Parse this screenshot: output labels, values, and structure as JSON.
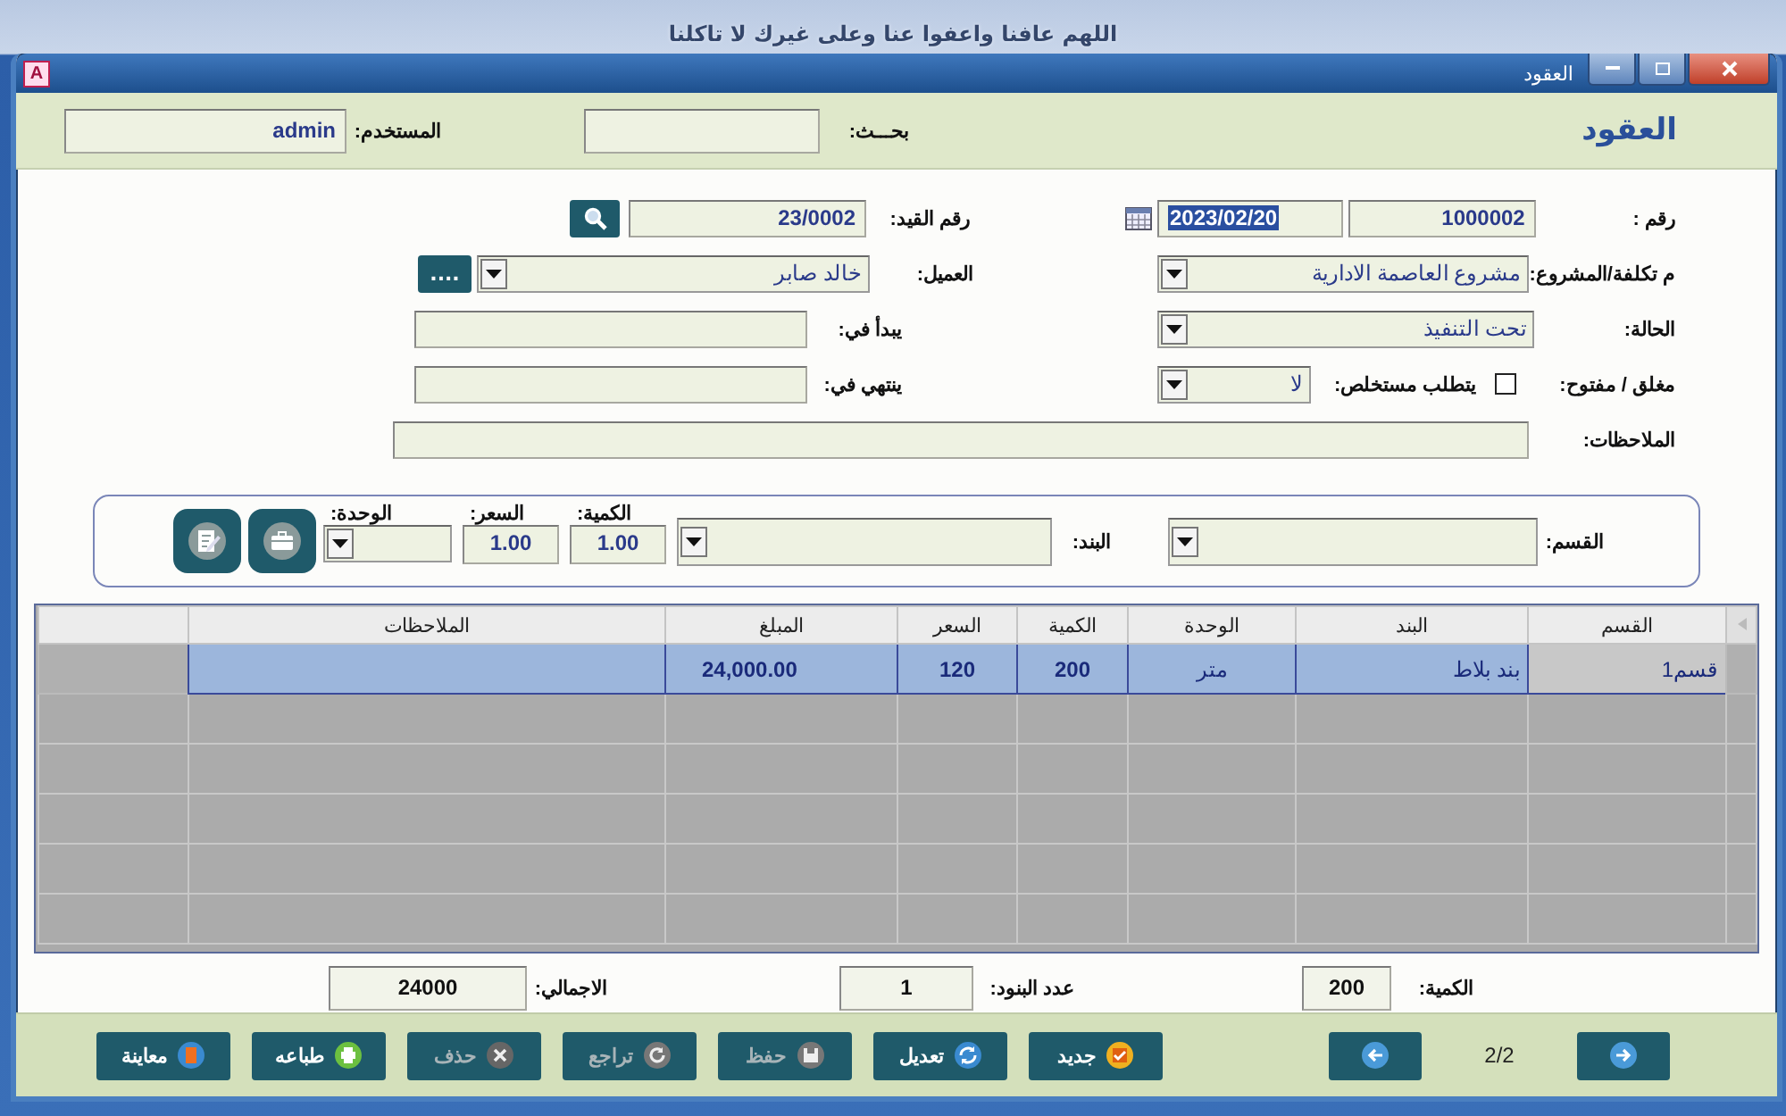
{
  "banner": {
    "text": "اللهم عافنا واعفوا عنا وعلى غيرك لا تاكلنا"
  },
  "window": {
    "app_badge": "A",
    "title": "العقود"
  },
  "header": {
    "title": "العقود",
    "search_label": "بحـــث:",
    "user_label": "المستخدم:",
    "user_value": "admin"
  },
  "contract": {
    "number": {
      "label": "رقم :",
      "value": "1000002"
    },
    "date": {
      "value": "2023/02/20",
      "selected": true
    },
    "entry_no": {
      "label": "رقم القيد:",
      "value": "23/0002"
    },
    "project": {
      "label": "م تكلفة/المشروع:",
      "value": "مشروع العاصمة الادارية"
    },
    "client": {
      "label": "العميل:",
      "value": "خالد صابر",
      "more_button": "...."
    },
    "status": {
      "label": "الحالة:",
      "value": "تحت التنفيذ"
    },
    "starts": {
      "label": "يبدأ في:"
    },
    "closed": {
      "label": "مغلق / مفتوح:",
      "checked": false
    },
    "requires_statement": {
      "label": "يتطلب مستخلص:",
      "value": "لا"
    },
    "ends": {
      "label": "ينتهي في:"
    },
    "notes": {
      "label": "الملاحظات:"
    }
  },
  "entry_panel": {
    "section": {
      "label": "القسم:"
    },
    "item": {
      "label": "البند:"
    },
    "quantity": {
      "label": "الكمية:",
      "value": "1.00"
    },
    "price": {
      "label": "السعر:",
      "value": "1.00"
    },
    "unit": {
      "label": "الوحدة:"
    }
  },
  "table": {
    "columns": [
      "القسم",
      "البند",
      "الوحدة",
      "الكمية",
      "السعر",
      "المبلغ",
      "الملاحظات"
    ],
    "rows": [
      {
        "cells": [
          "قسم1",
          "بند بلاط",
          "متر",
          "200",
          "120",
          "24,000.00",
          ""
        ],
        "selected": true
      }
    ]
  },
  "totals": [
    {
      "label": "الكمية:",
      "value": "200"
    },
    {
      "label": "عدد البنود:",
      "value": "1"
    },
    {
      "label": "الاجمالي:",
      "value": "24000"
    }
  ],
  "toolbar": {
    "position": "2/2",
    "buttons": [
      {
        "label": "جديد",
        "kind": "new",
        "disabled": false
      },
      {
        "label": "تعديل",
        "kind": "edit",
        "disabled": false
      },
      {
        "label": "حفظ",
        "kind": "save",
        "disabled": true
      },
      {
        "label": "تراجع",
        "kind": "undo",
        "disabled": true
      },
      {
        "label": "حذف",
        "kind": "delete",
        "disabled": true
      },
      {
        "label": "طباعه",
        "kind": "print",
        "disabled": false
      },
      {
        "label": "معاينة",
        "kind": "preview",
        "disabled": false
      }
    ]
  }
}
